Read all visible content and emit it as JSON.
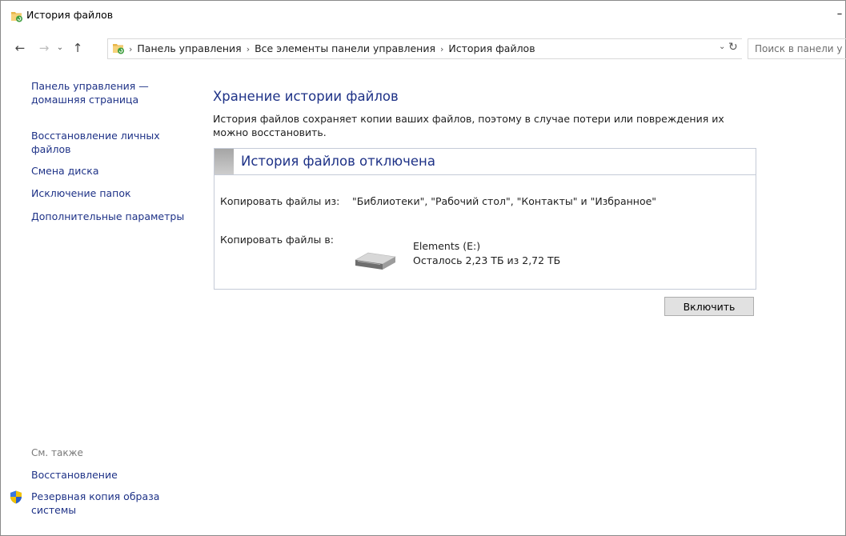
{
  "window": {
    "title": "История файлов",
    "minimize_glyph": "–"
  },
  "nav": {
    "back_glyph": "←",
    "forward_glyph": "→",
    "recent_glyph": "⌄",
    "up_glyph": "↑",
    "breadcrumbs": [
      "Панель управления",
      "Все элементы панели управления",
      "История файлов"
    ],
    "separator": "›",
    "dropdown_glyph": "⌄",
    "refresh_glyph": "↻",
    "search_placeholder": "Поиск в панели у"
  },
  "sidebar": {
    "home": "Панель управления — домашняя страница",
    "restore": "Восстановление личных файлов",
    "change_drive": "Смена диска",
    "exclude": "Исключение папок",
    "advanced": "Дополнительные параметры",
    "see_also": "См. также",
    "recovery": "Восстановление",
    "backup": "Резервная копия образа системы"
  },
  "main": {
    "title": "Хранение истории файлов",
    "description": "История файлов сохраняет копии ваших файлов, поэтому в случае потери или повреждения их можно восстановить.",
    "status_title": "История файлов отключена",
    "copy_from_label": "Копировать файлы из:",
    "copy_from_value": "\"Библиотеки\", \"Рабочий стол\", \"Контакты\" и \"Избранное\"",
    "copy_to_label": "Копировать файлы в:",
    "drive_name": "Elements (E:)",
    "drive_space": "Осталось 2,23 ТБ из 2,72 ТБ",
    "enable_button": "Включить"
  },
  "icons": {
    "app": "file-history-icon",
    "shield": "uac-shield-icon",
    "drive": "external-drive-icon"
  },
  "colors": {
    "link": "#1e3287",
    "title": "#1e3287",
    "border": "#c5cbd7",
    "button_bg": "#e1e1e1"
  }
}
